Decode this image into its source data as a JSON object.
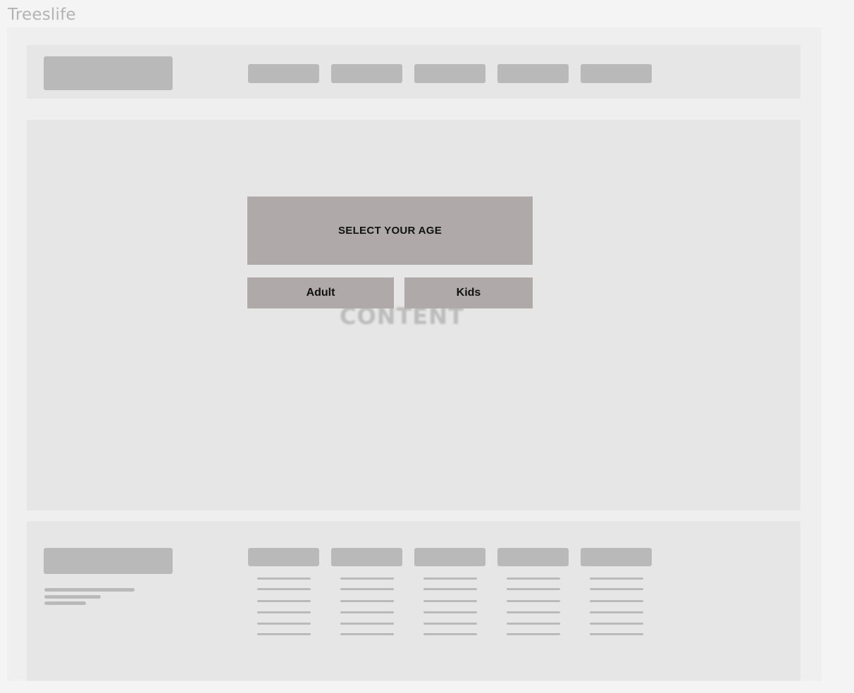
{
  "app": {
    "title": "Treeslife"
  },
  "content_placeholder": {
    "label": "CONTENT"
  },
  "age_selector": {
    "heading": "SELECT YOUR AGE",
    "options": [
      {
        "label": "Adult"
      },
      {
        "label": "Kids"
      }
    ]
  },
  "colors": {
    "page_background": "#f4f4f4",
    "frame_background": "#efefef",
    "section_background": "#e6e6e6",
    "placeholder_block": "#b9b9b9",
    "age_panel": "#afaaa9",
    "age_text": "#111111",
    "faded_text": "#b3b3b3"
  }
}
